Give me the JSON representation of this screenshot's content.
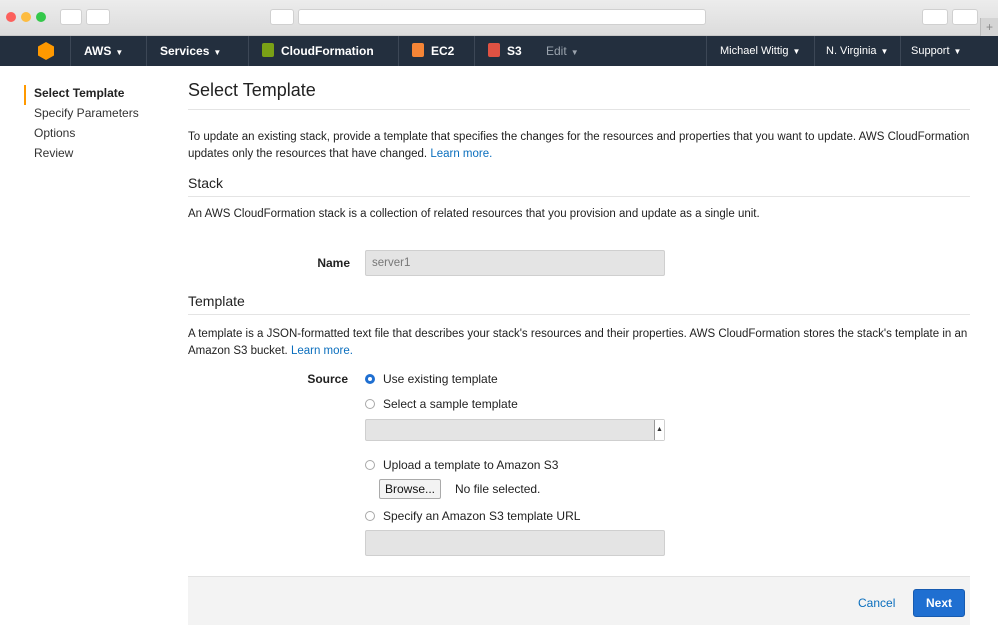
{
  "nav": {
    "aws_label": "AWS",
    "services_label": "Services",
    "cloudformation_label": "CloudFormation",
    "ec2_label": "EC2",
    "s3_label": "S3",
    "edit_label": "Edit",
    "user_label": "Michael Wittig",
    "region_label": "N. Virginia",
    "support_label": "Support"
  },
  "wizard": {
    "steps": [
      {
        "label": "Select Template",
        "active": true
      },
      {
        "label": "Specify Parameters",
        "active": false
      },
      {
        "label": "Options",
        "active": false
      },
      {
        "label": "Review",
        "active": false
      }
    ]
  },
  "main": {
    "title": "Select Template",
    "intro": "To update an existing stack, provide a template that specifies the changes for the resources and properties that you want to update. AWS CloudFormation updates only the resources that have changed.",
    "intro_link": "Learn more.",
    "stack": {
      "heading": "Stack",
      "description": "An AWS CloudFormation stack is a collection of related resources that you provision and update as a single unit.",
      "name_label": "Name",
      "name_value": "server1"
    },
    "template": {
      "heading": "Template",
      "description": "A template is a JSON-formatted text file that describes your stack's resources and their properties. AWS CloudFormation stores the stack's template in an Amazon S3 bucket.",
      "description_link": "Learn more.",
      "source_label": "Source",
      "options": {
        "existing": "Use existing template",
        "sample": "Select a sample template",
        "upload": "Upload a template to Amazon S3",
        "url": "Specify an Amazon S3 template URL"
      },
      "selected_option": "existing",
      "browse_label": "Browse...",
      "no_file_label": "No file selected."
    }
  },
  "footer": {
    "cancel_label": "Cancel",
    "next_label": "Next"
  },
  "colors": {
    "nav_bg": "#232f3e",
    "accent_orange": "#ff9900",
    "primary_blue": "#1f6fd1",
    "link_blue": "#0a6ebd",
    "cloudformation_icon": "#7aa116",
    "ec2_icon": "#f58536",
    "s3_icon": "#e05243"
  },
  "icons": {
    "aws_logo": "aws-cube-icon",
    "cloudformation": "cloudformation-icon",
    "ec2": "ec2-icon",
    "s3": "s3-icon"
  }
}
